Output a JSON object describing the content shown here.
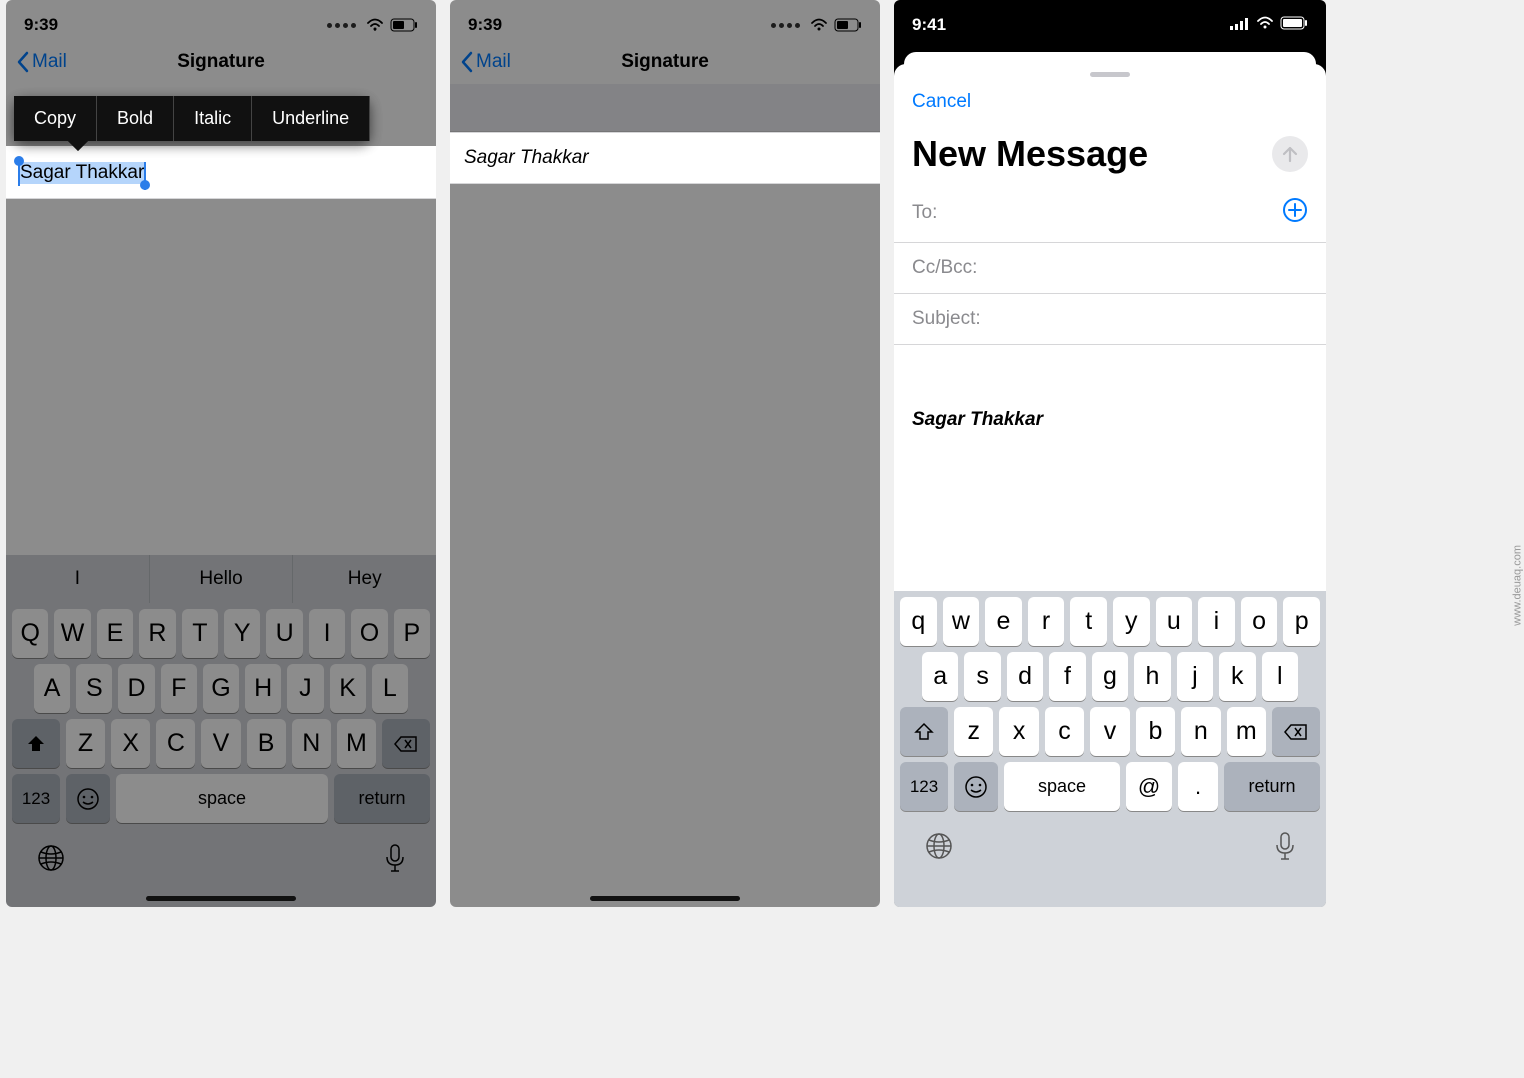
{
  "status": {
    "time_a": "9:39",
    "time_b": "9:39",
    "time_c": "9:41"
  },
  "nav": {
    "back_label": "Mail",
    "title": "Signature"
  },
  "edit_menu": {
    "copy": "Copy",
    "bold": "Bold",
    "italic": "Italic",
    "underline": "Underline"
  },
  "signature": {
    "text": "Sagar Thakkar"
  },
  "compose": {
    "cancel": "Cancel",
    "title": "New Message",
    "to_label": "To:",
    "ccbcc_label": "Cc/Bcc:",
    "subject_label": "Subject:",
    "signature": "Sagar Thakkar"
  },
  "suggestions": [
    "I",
    "Hello",
    "Hey"
  ],
  "kb": {
    "row1_upper": [
      "Q",
      "W",
      "E",
      "R",
      "T",
      "Y",
      "U",
      "I",
      "O",
      "P"
    ],
    "row2_upper": [
      "A",
      "S",
      "D",
      "F",
      "G",
      "H",
      "J",
      "K",
      "L"
    ],
    "row3_upper": [
      "Z",
      "X",
      "C",
      "V",
      "B",
      "N",
      "M"
    ],
    "row1_lower": [
      "q",
      "w",
      "e",
      "r",
      "t",
      "y",
      "u",
      "i",
      "o",
      "p"
    ],
    "row2_lower": [
      "a",
      "s",
      "d",
      "f",
      "g",
      "h",
      "j",
      "k",
      "l"
    ],
    "row3_lower": [
      "z",
      "x",
      "c",
      "v",
      "b",
      "n",
      "m"
    ],
    "nums": "123",
    "space": "space",
    "return": "return",
    "at": "@",
    "dot": "."
  },
  "watermark": "www.deuaq.com"
}
